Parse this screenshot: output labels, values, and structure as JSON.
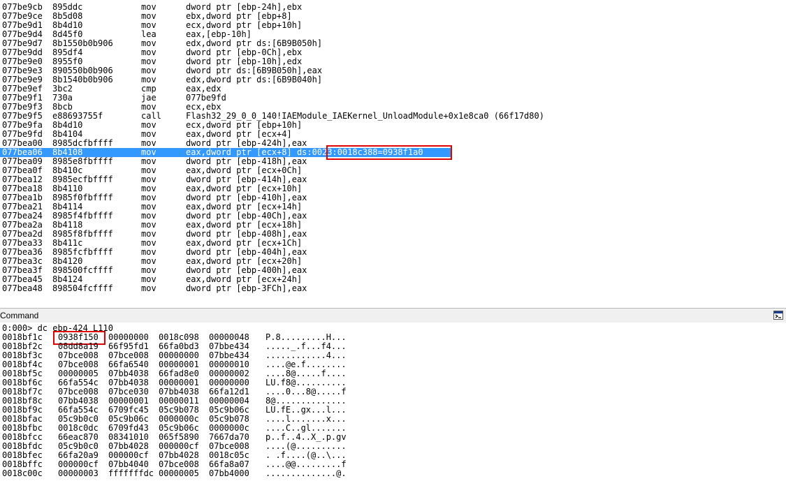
{
  "disassembly": {
    "rows": [
      {
        "addr": "077be9cb",
        "bytes": "895ddc",
        "mnemonic": "mov",
        "operands": "dword ptr [ebp-24h],ebx"
      },
      {
        "addr": "077be9ce",
        "bytes": "8b5d08",
        "mnemonic": "mov",
        "operands": "ebx,dword ptr [ebp+8]"
      },
      {
        "addr": "077be9d1",
        "bytes": "8b4d10",
        "mnemonic": "mov",
        "operands": "ecx,dword ptr [ebp+10h]"
      },
      {
        "addr": "077be9d4",
        "bytes": "8d45f0",
        "mnemonic": "lea",
        "operands": "eax,[ebp-10h]"
      },
      {
        "addr": "077be9d7",
        "bytes": "8b1550b0b906",
        "mnemonic": "mov",
        "operands": "edx,dword ptr ds:[6B9B050h]"
      },
      {
        "addr": "077be9dd",
        "bytes": "895df4",
        "mnemonic": "mov",
        "operands": "dword ptr [ebp-0Ch],ebx"
      },
      {
        "addr": "077be9e0",
        "bytes": "8955f0",
        "mnemonic": "mov",
        "operands": "dword ptr [ebp-10h],edx"
      },
      {
        "addr": "077be9e3",
        "bytes": "890550b0b906",
        "mnemonic": "mov",
        "operands": "dword ptr ds:[6B9B050h],eax"
      },
      {
        "addr": "077be9e9",
        "bytes": "8b1540b0b906",
        "mnemonic": "mov",
        "operands": "edx,dword ptr ds:[6B9B040h]"
      },
      {
        "addr": "077be9ef",
        "bytes": "3bc2",
        "mnemonic": "cmp",
        "operands": "eax,edx"
      },
      {
        "addr": "077be9f1",
        "bytes": "730a",
        "mnemonic": "jae",
        "operands": "077be9fd"
      },
      {
        "addr": "077be9f3",
        "bytes": "8bcb",
        "mnemonic": "mov",
        "operands": "ecx,ebx"
      },
      {
        "addr": "077be9f5",
        "bytes": "e88693755f",
        "mnemonic": "call",
        "operands": "Flash32_29_0_0_140!IAEModule_IAEKernel_UnloadModule+0x1e8ca0 (66f17d80)"
      },
      {
        "addr": "077be9fa",
        "bytes": "8b4d10",
        "mnemonic": "mov",
        "operands": "ecx,dword ptr [ebp+10h]"
      },
      {
        "addr": "077be9fd",
        "bytes": "8b4104",
        "mnemonic": "mov",
        "operands": "eax,dword ptr [ecx+4]"
      },
      {
        "addr": "077bea00",
        "bytes": "8985dcfbffff",
        "mnemonic": "mov",
        "operands": "dword ptr [ebp-424h],eax"
      },
      {
        "addr": "077bea06",
        "bytes": "8b4108",
        "mnemonic": "mov",
        "operands": "eax,dword ptr [ecx+8] ds:0023:0018c388=0938f1a0",
        "selected": true
      },
      {
        "addr": "077bea09",
        "bytes": "8985e8fbffff",
        "mnemonic": "mov",
        "operands": "dword ptr [ebp-418h],eax"
      },
      {
        "addr": "077bea0f",
        "bytes": "8b410c",
        "mnemonic": "mov",
        "operands": "eax,dword ptr [ecx+0Ch]"
      },
      {
        "addr": "077bea12",
        "bytes": "8985ecfbffff",
        "mnemonic": "mov",
        "operands": "dword ptr [ebp-414h],eax"
      },
      {
        "addr": "077bea18",
        "bytes": "8b4110",
        "mnemonic": "mov",
        "operands": "eax,dword ptr [ecx+10h]"
      },
      {
        "addr": "077bea1b",
        "bytes": "8985f0fbffff",
        "mnemonic": "mov",
        "operands": "dword ptr [ebp-410h],eax"
      },
      {
        "addr": "077bea21",
        "bytes": "8b4114",
        "mnemonic": "mov",
        "operands": "eax,dword ptr [ecx+14h]"
      },
      {
        "addr": "077bea24",
        "bytes": "8985f4fbffff",
        "mnemonic": "mov",
        "operands": "dword ptr [ebp-40Ch],eax"
      },
      {
        "addr": "077bea2a",
        "bytes": "8b4118",
        "mnemonic": "mov",
        "operands": "eax,dword ptr [ecx+18h]"
      },
      {
        "addr": "077bea2d",
        "bytes": "8985f8fbffff",
        "mnemonic": "mov",
        "operands": "dword ptr [ebp-408h],eax"
      },
      {
        "addr": "077bea33",
        "bytes": "8b411c",
        "mnemonic": "mov",
        "operands": "eax,dword ptr [ecx+1Ch]"
      },
      {
        "addr": "077bea36",
        "bytes": "8985fcfbffff",
        "mnemonic": "mov",
        "operands": "dword ptr [ebp-404h],eax"
      },
      {
        "addr": "077bea3c",
        "bytes": "8b4120",
        "mnemonic": "mov",
        "operands": "eax,dword ptr [ecx+20h]"
      },
      {
        "addr": "077bea3f",
        "bytes": "898500fcffff",
        "mnemonic": "mov",
        "operands": "dword ptr [ebp-400h],eax"
      },
      {
        "addr": "077bea45",
        "bytes": "8b4124",
        "mnemonic": "mov",
        "operands": "eax,dword ptr [ecx+24h]"
      },
      {
        "addr": "077bea48",
        "bytes": "898504fcffff",
        "mnemonic": "mov",
        "operands": "dword ptr [ebp-3FCh],eax"
      }
    ],
    "highlight_text": "0023:0018c388=0938f1a0"
  },
  "command": {
    "title": "Command",
    "button_icon": "command-window-icon",
    "prompt": "0:000> dc ebp-424 L110",
    "memory_rows": [
      {
        "addr": "0018bf1c",
        "w1": "0938f150",
        "w2": "00000000",
        "w3": "0018c098",
        "w4": "00000048",
        "ascii": "P.8.........H..."
      },
      {
        "addr": "0018bf2c",
        "w1": "08dd8a19",
        "w2": "66f95fd1",
        "w3": "66fa0bd3",
        "w4": "07bbe434",
        "ascii": "....._.f...f4..."
      },
      {
        "addr": "0018bf3c",
        "w1": "07bce008",
        "w2": "07bce008",
        "w3": "00000000",
        "w4": "07bbe434",
        "ascii": "............4..."
      },
      {
        "addr": "0018bf4c",
        "w1": "07bce008",
        "w2": "66fa6540",
        "w3": "00000001",
        "w4": "00000010",
        "ascii": "....@e.f........"
      },
      {
        "addr": "0018bf5c",
        "w1": "00000005",
        "w2": "07bb4038",
        "w3": "66fad8e0",
        "w4": "00000002",
        "ascii": "....8@.....f...."
      },
      {
        "addr": "0018bf6c",
        "w1": "66fa554c",
        "w2": "07bb4038",
        "w3": "00000001",
        "w4": "00000000",
        "ascii": "LU.f8@.........."
      },
      {
        "addr": "0018bf7c",
        "w1": "07bce008",
        "w2": "07bce030",
        "w3": "07bb4038",
        "w4": "66fa12d1",
        "ascii": "....0...8@.....f"
      },
      {
        "addr": "0018bf8c",
        "w1": "07bb4038",
        "w2": "00000001",
        "w3": "00000011",
        "w4": "00000004",
        "ascii": "8@.............."
      },
      {
        "addr": "0018bf9c",
        "w1": "66fa554c",
        "w2": "6709fc45",
        "w3": "05c9b078",
        "w4": "05c9b06c",
        "ascii": "LU.fE..gx...l..."
      },
      {
        "addr": "0018bfac",
        "w1": "05c9b0c0",
        "w2": "05c9b06c",
        "w3": "0000000c",
        "w4": "05c9b078",
        "ascii": "....l.......x..."
      },
      {
        "addr": "0018bfbc",
        "w1": "0018c0dc",
        "w2": "6709fd43",
        "w3": "05c9b06c",
        "w4": "0000000c",
        "ascii": "....C..gl......."
      },
      {
        "addr": "0018bfcc",
        "w1": "66eac870",
        "w2": "08341010",
        "w3": "065f5890",
        "w4": "7667da70",
        "ascii": "p..f..4..X_.p.gv"
      },
      {
        "addr": "0018bfdc",
        "w1": "05c9b0c0",
        "w2": "07bb4028",
        "w3": "000000cf",
        "w4": "07bce008",
        "ascii": "....(@.........."
      },
      {
        "addr": "0018bfec",
        "w1": "66fa20a9",
        "w2": "000000cf",
        "w3": "07bb4028",
        "w4": "0018c05c",
        "ascii": ". .f....(@..\\..."
      },
      {
        "addr": "0018bffc",
        "w1": "000000cf",
        "w2": "07bb4040",
        "w3": "07bce008",
        "w4": "66fa8a07",
        "ascii": "....@@.........f"
      },
      {
        "addr": "0018c00c",
        "w1": "00000003",
        "w2": "fffffffdc",
        "w3": "00000005",
        "w4": "07bb4000",
        "ascii": "..............@."
      }
    ]
  },
  "colors": {
    "selection": "#3399ff",
    "highlight_box": "#e00000"
  }
}
